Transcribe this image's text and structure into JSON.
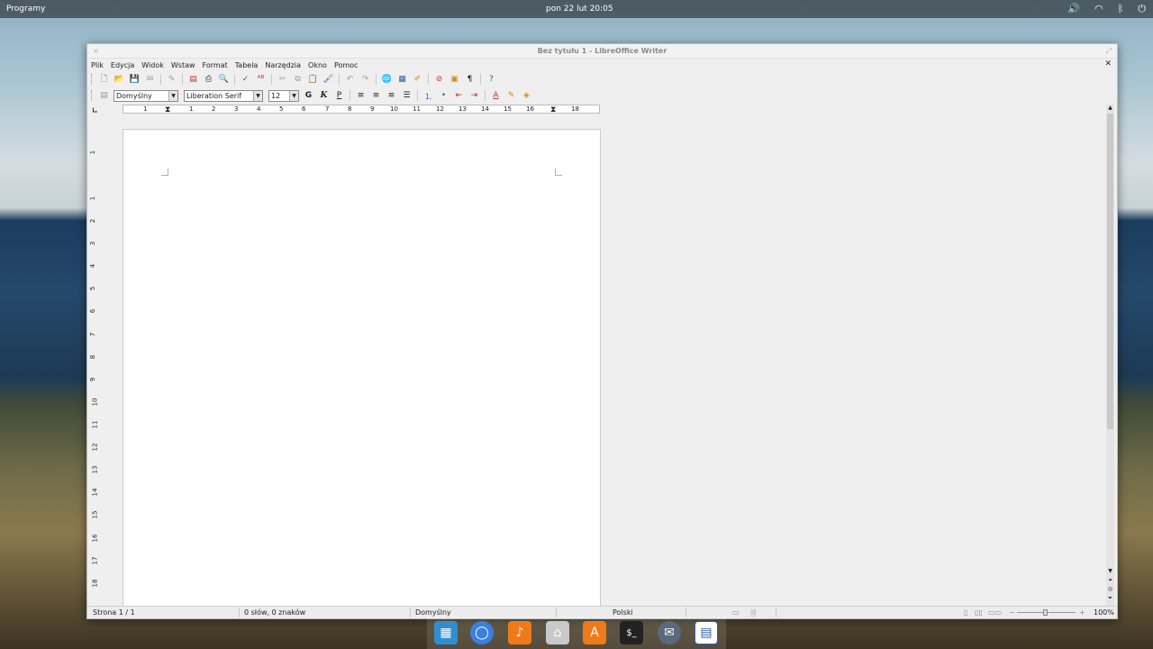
{
  "top_panel": {
    "apps_label": "Programy",
    "clock": "pon 22 lut   20:05",
    "tray_icons": [
      "volume-icon",
      "wifi-icon",
      "bluetooth-icon",
      "power-icon"
    ]
  },
  "window": {
    "title": "Bez tytułu 1 - LibreOffice Writer",
    "close_glyph": "×",
    "maximize_glyph": "⤢",
    "doc_close_glyph": "✕"
  },
  "menu": [
    "Plik",
    "Edycja",
    "Widok",
    "Wstaw",
    "Format",
    "Tabela",
    "Narzędzia",
    "Okno",
    "Pomoc"
  ],
  "formatting": {
    "style": "Domyślny",
    "font": "Liberation Serif",
    "size": "12",
    "bold": "G",
    "italic": "K",
    "underline": "P"
  },
  "ruler": {
    "horizontal_labels": [
      "1",
      "1",
      "2",
      "3",
      "4",
      "5",
      "6",
      "7",
      "8",
      "9",
      "10",
      "11",
      "12",
      "13",
      "14",
      "15",
      "16",
      "17",
      "18"
    ],
    "vertical_labels": [
      "1",
      "1",
      "2",
      "3",
      "4",
      "5",
      "6",
      "7",
      "8",
      "9",
      "10",
      "11",
      "12",
      "13",
      "14",
      "15",
      "16",
      "17",
      "18"
    ]
  },
  "status": {
    "page": "Strona 1 / 1",
    "words": "0 słów, 0 znaków",
    "page_style": "Domyślny",
    "language": "Polski",
    "zoom": "100%"
  },
  "dock_icons": [
    "files-app-icon",
    "browser-icon",
    "music-icon",
    "home-folder-icon",
    "app-center-icon",
    "terminal-icon",
    "mail-icon",
    "writer-icon"
  ]
}
